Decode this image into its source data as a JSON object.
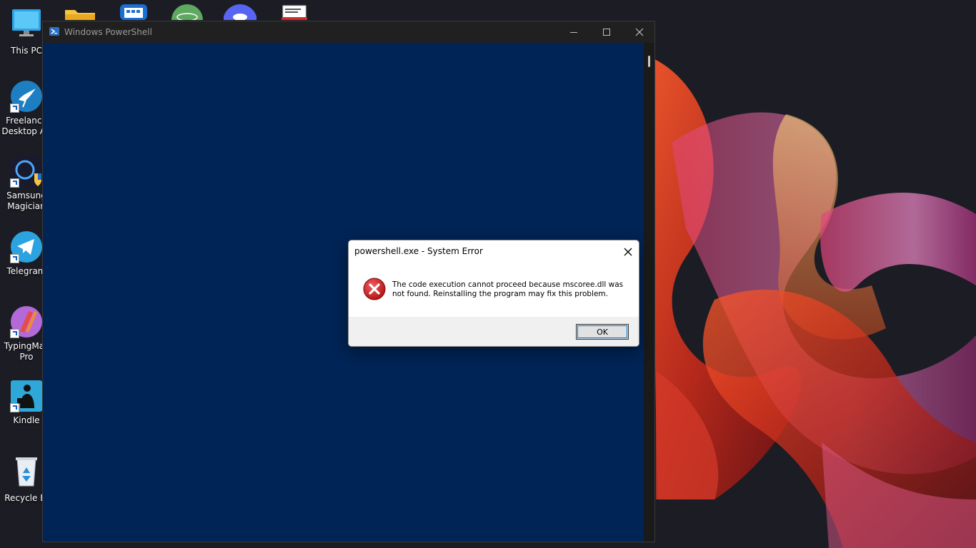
{
  "desktop": {
    "icons": [
      {
        "label": "This PC",
        "label2": "",
        "icon": "monitor-icon"
      },
      {
        "label": "Freelance",
        "label2": "Desktop Ap",
        "icon": "hummingbird-icon"
      },
      {
        "label": "Samsung",
        "label2": "Magician",
        "icon": "magnifier-shield-icon"
      },
      {
        "label": "Telegram",
        "label2": "",
        "icon": "telegram-icon"
      },
      {
        "label": "TypingMas",
        "label2": "Pro",
        "icon": "typing-master-icon"
      },
      {
        "label": "Kindle",
        "label2": "",
        "icon": "kindle-reader-icon"
      },
      {
        "label": "Recycle Bi",
        "label2": "",
        "icon": "recycle-bin-icon"
      }
    ],
    "top_icons": [
      "folder-icon",
      "app-grid-icon",
      "atom-app-icon",
      "discord-icon",
      "document-icon"
    ]
  },
  "powershell_window": {
    "title": "Windows PowerShell",
    "minimize": "minimize-icon",
    "maximize": "maximize-icon",
    "close": "close-icon",
    "console_color": "#012456"
  },
  "error_dialog": {
    "title": "powershell.exe - System Error",
    "message_line1": "The code execution cannot proceed because mscoree.dll was",
    "message_line2": "not found. Reinstalling the program may fix this problem.",
    "ok_label": "OK",
    "icon": "error-x-icon"
  }
}
